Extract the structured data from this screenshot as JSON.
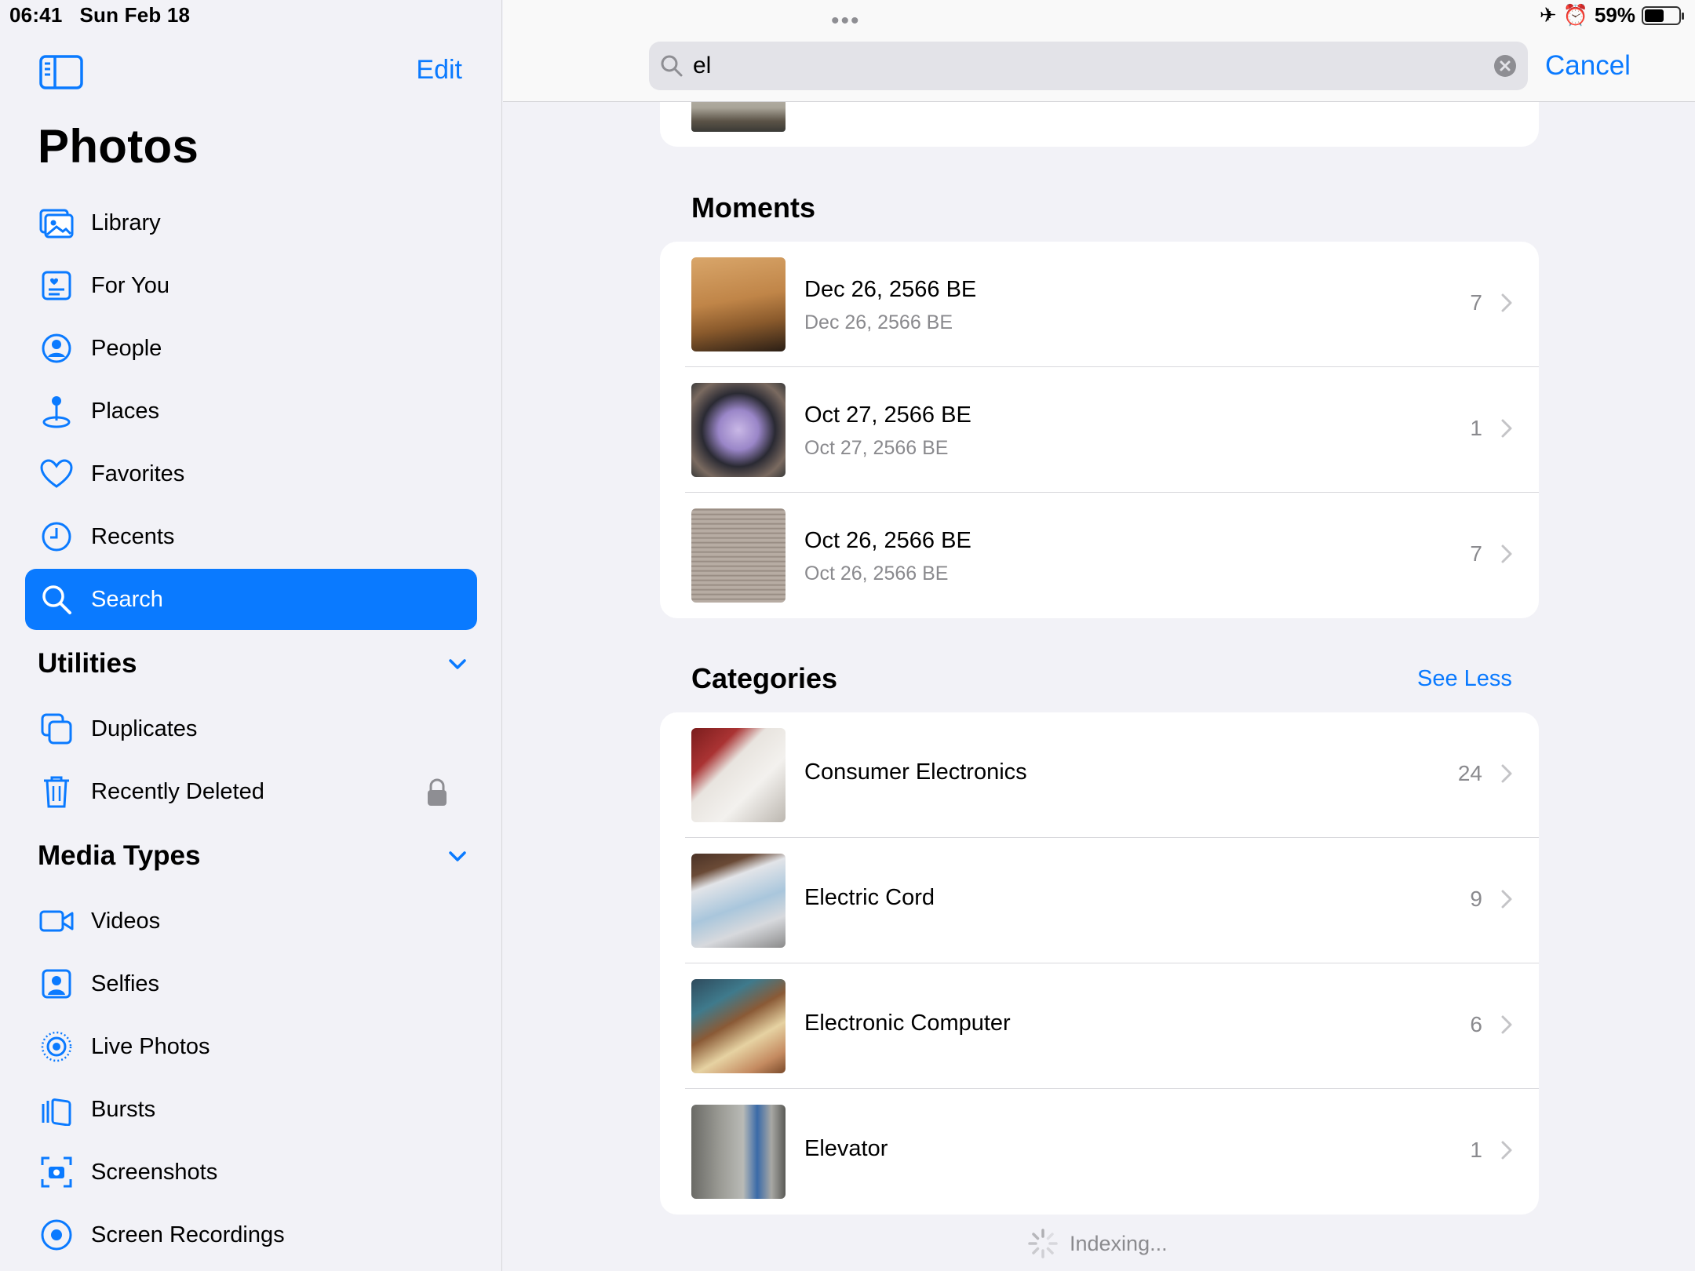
{
  "status": {
    "time": "06:41",
    "date": "Sun Feb 18",
    "battery": "59%"
  },
  "sidebar": {
    "edit_label": "Edit",
    "title": "Photos",
    "items": [
      {
        "label": "Library",
        "icon": "library-icon"
      },
      {
        "label": "For You",
        "icon": "for-you-icon"
      },
      {
        "label": "People",
        "icon": "people-icon"
      },
      {
        "label": "Places",
        "icon": "places-icon"
      },
      {
        "label": "Favorites",
        "icon": "heart-icon"
      },
      {
        "label": "Recents",
        "icon": "clock-icon"
      },
      {
        "label": "Search",
        "icon": "search-icon",
        "selected": true
      }
    ],
    "utilities": {
      "title": "Utilities",
      "items": [
        {
          "label": "Duplicates",
          "icon": "duplicates-icon"
        },
        {
          "label": "Recently Deleted",
          "icon": "trash-icon",
          "locked": true
        }
      ]
    },
    "media_types": {
      "title": "Media Types",
      "items": [
        {
          "label": "Videos",
          "icon": "video-icon"
        },
        {
          "label": "Selfies",
          "icon": "selfie-icon"
        },
        {
          "label": "Live Photos",
          "icon": "live-photo-icon"
        },
        {
          "label": "Bursts",
          "icon": "bursts-icon"
        },
        {
          "label": "Screenshots",
          "icon": "screenshot-icon"
        },
        {
          "label": "Screen Recordings",
          "icon": "screen-recording-icon"
        }
      ]
    }
  },
  "search": {
    "query": "el",
    "cancel_label": "Cancel"
  },
  "moments": {
    "title": "Moments",
    "rows": [
      {
        "title": "Dec 26, 2566 BE",
        "subtitle": "Dec 26, 2566 BE",
        "count": "7"
      },
      {
        "title": "Oct 27, 2566 BE",
        "subtitle": "Oct 27, 2566 BE",
        "count": "1"
      },
      {
        "title": "Oct 26, 2566 BE",
        "subtitle": "Oct 26, 2566 BE",
        "count": "7"
      }
    ]
  },
  "categories": {
    "title": "Categories",
    "see_less_label": "See Less",
    "rows": [
      {
        "title": "Consumer Electronics",
        "count": "24"
      },
      {
        "title": "Electric Cord",
        "count": "9"
      },
      {
        "title": "Electronic Computer",
        "count": "6"
      },
      {
        "title": "Elevator",
        "count": "1"
      }
    ]
  },
  "indexing_label": "Indexing...",
  "colors": {
    "accent": "#0a7aff",
    "background": "#f2f2f7",
    "secondary_text": "#8a8a8e"
  }
}
